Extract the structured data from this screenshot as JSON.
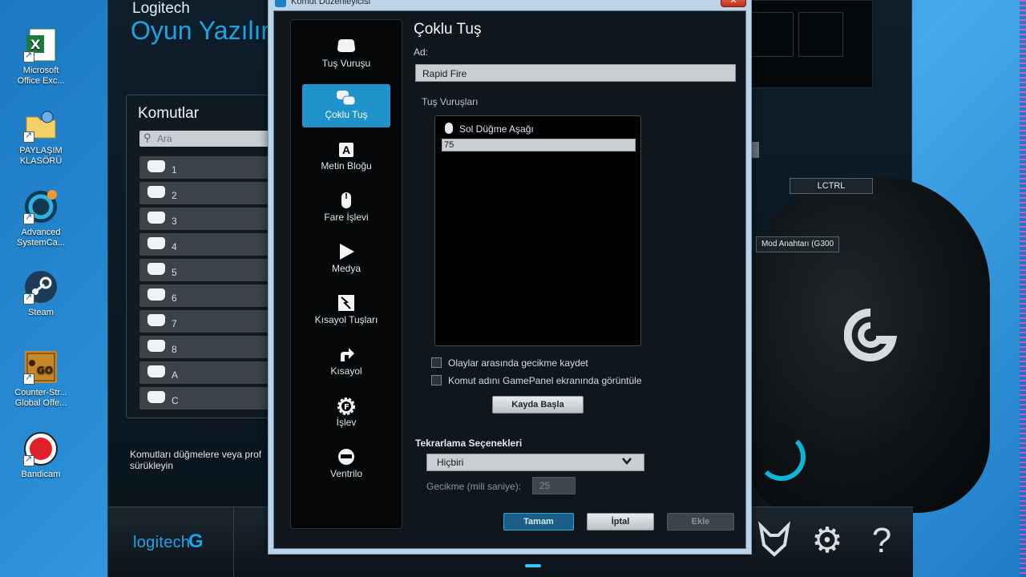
{
  "desktop": {
    "icons": [
      {
        "label": "Microsoft\nOffice Exc...",
        "icon": "excel-icon"
      },
      {
        "label": "PAYLAŞIM\nKLASÖRÜ",
        "icon": "shared-folder-icon"
      },
      {
        "label": "Advanced\nSystemCa...",
        "icon": "advanced-systemcare-icon"
      },
      {
        "label": "Steam",
        "icon": "steam-icon"
      },
      {
        "label": "Counter-Str...\nGlobal Offe...",
        "icon": "csgo-icon"
      },
      {
        "label": "Bandicam",
        "icon": "bandicam-icon"
      }
    ]
  },
  "lgs": {
    "brand": "Logitech",
    "title": "Oyun Yazılır",
    "commands": {
      "title": "Komutlar",
      "search_placeholder": "Ara",
      "items": [
        "1",
        "2",
        "3",
        "4",
        "5",
        "6",
        "7",
        "8",
        "A",
        "C"
      ],
      "hint": "Komutları düğmelere veya prof sürükleyin"
    },
    "mouse_labels": {
      "lctrl": "LCTRL",
      "mod_key": "Mod Anahtarı (G300"
    },
    "footer_logo": "logitech"
  },
  "dialog": {
    "title": "Komut Düzenleyicisi",
    "categories": [
      {
        "label": "Tuş Vuruşu",
        "icon": "keystroke-icon",
        "active": false
      },
      {
        "label": "Çoklu Tuş",
        "icon": "multikey-icon",
        "active": true
      },
      {
        "label": "Metin Bloğu",
        "icon": "text-block-icon",
        "active": false,
        "glyph": "A"
      },
      {
        "label": "Fare İşlevi",
        "icon": "mouse-function-icon",
        "active": false
      },
      {
        "label": "Medya",
        "icon": "media-play-icon",
        "active": false
      },
      {
        "label": "Kısayol Tuşları",
        "icon": "hotkey-icon",
        "active": false
      },
      {
        "label": "Kısayol",
        "icon": "shortcut-arrow-icon",
        "active": false
      },
      {
        "label": "İşlev",
        "icon": "function-gear-icon",
        "active": false
      },
      {
        "label": "Ventrilo",
        "icon": "ventrilo-icon",
        "active": false
      }
    ],
    "heading": "Çoklu Tuş",
    "name_label": "Ad:",
    "name_value": "Rapid Fire",
    "keystrokes_label": "Tuş Vuruşları",
    "events": [
      {
        "text": "Sol Düğme Aşağı",
        "icon": "mouse-icon"
      }
    ],
    "delay_edit_value": "75",
    "checkboxes": [
      {
        "label": "Olaylar arasında gecikme kaydet",
        "checked": false
      },
      {
        "label": "Komut adını GamePanel ekranında görüntüle",
        "checked": false
      }
    ],
    "record_button": "Kayda Başla",
    "repeat_label": "Tekrarlama Seçenekleri",
    "repeat_value": "Hiçbiri",
    "delay_label": "Gecikme (mili saniye):",
    "delay_value": "25",
    "ok_button": "Tamam",
    "cancel_button": "İptal",
    "add_button": "Ekle"
  }
}
